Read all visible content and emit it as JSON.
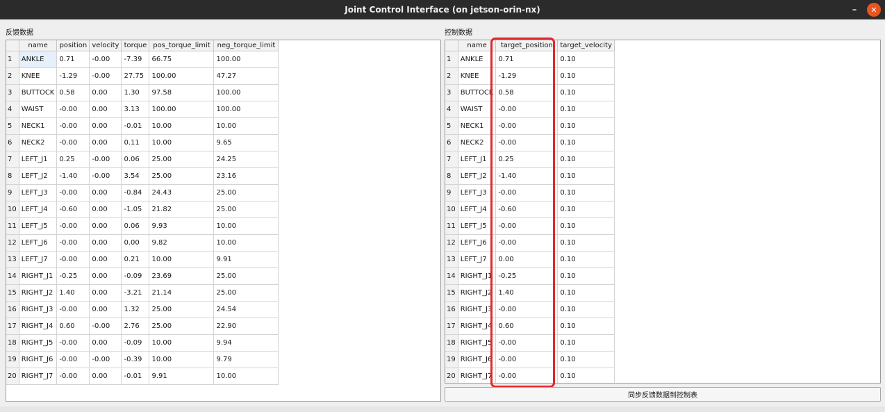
{
  "window": {
    "title": "Joint Control Interface (on jetson-orin-nx)",
    "min_glyph": "–",
    "close_glyph": "✕"
  },
  "feedback": {
    "label": "反馈数据",
    "columns": [
      "name",
      "position",
      "velocity",
      "torque",
      "pos_torque_limit",
      "neg_torque_limit"
    ],
    "rows": [
      [
        "ANKLE",
        "0.71",
        "-0.00",
        "-7.39",
        "66.75",
        "100.00"
      ],
      [
        "KNEE",
        "-1.29",
        "-0.00",
        "27.75",
        "100.00",
        "47.27"
      ],
      [
        "BUTTOCK",
        "0.58",
        "0.00",
        "1.30",
        "97.58",
        "100.00"
      ],
      [
        "WAIST",
        "-0.00",
        "0.00",
        "3.13",
        "100.00",
        "100.00"
      ],
      [
        "NECK1",
        "-0.00",
        "0.00",
        "-0.01",
        "10.00",
        "10.00"
      ],
      [
        "NECK2",
        "-0.00",
        "0.00",
        "0.11",
        "10.00",
        "9.65"
      ],
      [
        "LEFT_J1",
        "0.25",
        "-0.00",
        "0.06",
        "25.00",
        "24.25"
      ],
      [
        "LEFT_J2",
        "-1.40",
        "-0.00",
        "3.54",
        "25.00",
        "23.16"
      ],
      [
        "LEFT_J3",
        "-0.00",
        "0.00",
        "-0.84",
        "24.43",
        "25.00"
      ],
      [
        "LEFT_J4",
        "-0.60",
        "0.00",
        "-1.05",
        "21.82",
        "25.00"
      ],
      [
        "LEFT_J5",
        "-0.00",
        "0.00",
        "0.06",
        "9.93",
        "10.00"
      ],
      [
        "LEFT_J6",
        "-0.00",
        "0.00",
        "0.00",
        "9.82",
        "10.00"
      ],
      [
        "LEFT_J7",
        "-0.00",
        "0.00",
        "0.21",
        "10.00",
        "9.91"
      ],
      [
        "RIGHT_J1",
        "-0.25",
        "0.00",
        "-0.09",
        "23.69",
        "25.00"
      ],
      [
        "RIGHT_J2",
        "1.40",
        "0.00",
        "-3.21",
        "21.14",
        "25.00"
      ],
      [
        "RIGHT_J3",
        "-0.00",
        "0.00",
        "1.32",
        "25.00",
        "24.54"
      ],
      [
        "RIGHT_J4",
        "0.60",
        "-0.00",
        "2.76",
        "25.00",
        "22.90"
      ],
      [
        "RIGHT_J5",
        "-0.00",
        "0.00",
        "-0.09",
        "10.00",
        "9.94"
      ],
      [
        "RIGHT_J6",
        "-0.00",
        "-0.00",
        "-0.39",
        "10.00",
        "9.79"
      ],
      [
        "RIGHT_J7",
        "-0.00",
        "0.00",
        "-0.01",
        "9.91",
        "10.00"
      ]
    ]
  },
  "control": {
    "label": "控制数据",
    "columns": [
      "name",
      "target_position",
      "target_velocity"
    ],
    "rows": [
      [
        "ANKLE",
        "0.71",
        "0.10"
      ],
      [
        "KNEE",
        "-1.29",
        "0.10"
      ],
      [
        "BUTTOCK",
        "0.58",
        "0.10"
      ],
      [
        "WAIST",
        "-0.00",
        "0.10"
      ],
      [
        "NECK1",
        "-0.00",
        "0.10"
      ],
      [
        "NECK2",
        "-0.00",
        "0.10"
      ],
      [
        "LEFT_J1",
        "0.25",
        "0.10"
      ],
      [
        "LEFT_J2",
        "-1.40",
        "0.10"
      ],
      [
        "LEFT_J3",
        "-0.00",
        "0.10"
      ],
      [
        "LEFT_J4",
        "-0.60",
        "0.10"
      ],
      [
        "LEFT_J5",
        "-0.00",
        "0.10"
      ],
      [
        "LEFT_J6",
        "-0.00",
        "0.10"
      ],
      [
        "LEFT_J7",
        "0.00",
        "0.10"
      ],
      [
        "RIGHT_J1",
        "-0.25",
        "0.10"
      ],
      [
        "RIGHT_J2",
        "1.40",
        "0.10"
      ],
      [
        "RIGHT_J3",
        "-0.00",
        "0.10"
      ],
      [
        "RIGHT_J4",
        "0.60",
        "0.10"
      ],
      [
        "RIGHT_J5",
        "-0.00",
        "0.10"
      ],
      [
        "RIGHT_J6",
        "-0.00",
        "0.10"
      ],
      [
        "RIGHT_J7",
        "-0.00",
        "0.10"
      ]
    ],
    "sync_button_label": "同步反馈数据到控制表"
  },
  "colors": {
    "highlight": "#e0282d",
    "selected_cell": "#e6f0fa",
    "titlebar": "#2b2b2b"
  }
}
